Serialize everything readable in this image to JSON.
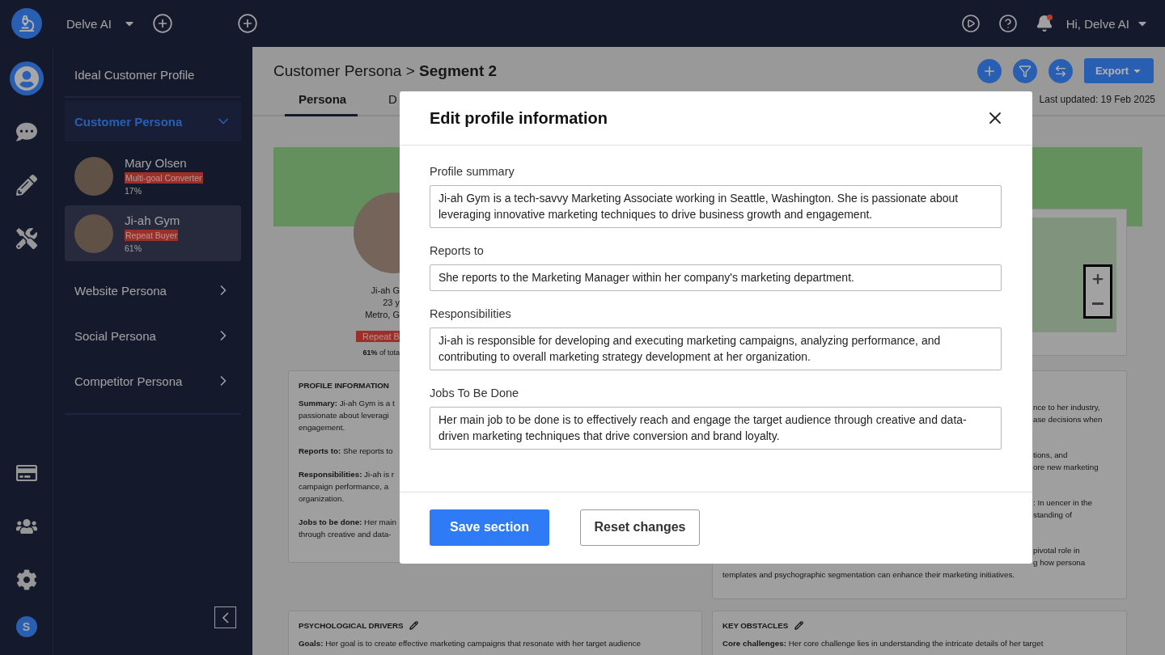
{
  "topbar": {
    "workspace": "Delve AI",
    "greeting": "Hi, Delve AI",
    "notifications_unread": true
  },
  "rail": [
    {
      "kind": "profile",
      "selected": true
    },
    {
      "kind": "chat",
      "selected": false
    },
    {
      "kind": "pencil",
      "selected": false
    },
    {
      "kind": "tools",
      "selected": false
    },
    {
      "kind": "card",
      "selected": false
    },
    {
      "kind": "team",
      "selected": false
    },
    {
      "kind": "settings",
      "selected": false
    }
  ],
  "user_initial": "S",
  "nav": {
    "items": [
      {
        "kind": "link",
        "label": "Ideal Customer Profile"
      },
      {
        "kind": "group",
        "label": "Customer Persona",
        "expanded": true,
        "children": [
          {
            "name": "Mary Olsen",
            "tag": "Multi-goal Converter",
            "share": "17%",
            "selected": false
          },
          {
            "name": "Ji-ah Gym",
            "tag": "Repeat Buyer",
            "share": "61%",
            "selected": true
          }
        ]
      },
      {
        "kind": "group",
        "label": "Website Persona",
        "expanded": false
      },
      {
        "kind": "group",
        "label": "Social Persona",
        "expanded": false
      },
      {
        "kind": "group",
        "label": "Competitor Persona",
        "expanded": false
      }
    ]
  },
  "main": {
    "title": "Customer Persona > **Segment 2**",
    "export_label": "Export",
    "last_updated": "Last updated: 19 Feb 2025",
    "tabs": [
      {
        "label": "Persona",
        "selected": true
      },
      {
        "label": "D",
        "selected": false
      }
    ],
    "persona": {
      "name": "Ji-ah G",
      "age": "23 y",
      "location": "Metro, G",
      "tag": "Repeat B",
      "share": "**61%** of tota"
    },
    "profile_card": {
      "title": "PROFILE INFORMATION",
      "paragraphs": [
        [
          "**Summary:** Ji-ah Gym is a t",
          "passionate about leveragi",
          "engagement."
        ],
        [
          "**Reports to:** She reports to"
        ],
        [
          "**Responsibilities:** Ji-ah is r",
          "campaign performance, a",
          "organization."
        ],
        [
          "**Jobs to be done:** Her main",
          "through creative and data-"
        ]
      ]
    },
    "right_card": {
      "paragraphs": [
        [
          "nce to her industry,",
          "ase decisions when"
        ],
        [
          "tions, and",
          "ore new marketing"
        ],
        [
          ": In uencer in the",
          "standing of"
        ],
        [
          "pivotal role in",
          "g how persona"
        ]
      ],
      "last_line": "templates and psychographic segmentation can enhance their marketing initiatives."
    },
    "bottom_cards": [
      {
        "title": "PSYCHOLOGICAL DRIVERS",
        "text": "**Goals:** Her goal is to create effective marketing campaigns that resonate with her target audience"
      },
      {
        "title": "KEY OBSTACLES",
        "text": "**Core challenges:** Her core challenge lies in understanding the intricate details of her target"
      }
    ]
  },
  "dialog": {
    "title": "Edit profile information",
    "fields": [
      {
        "label": "Profile summary",
        "value": "Ji-ah Gym is a tech-savvy Marketing Associate working in Seattle, Washington. She is passionate about leveraging innovative marketing techniques to drive business growth and engagement."
      },
      {
        "label": "Reports to",
        "value": "She reports to the Marketing Manager within her company's marketing department."
      },
      {
        "label": "Responsibilities",
        "value": "Ji-ah is responsible for developing and executing marketing campaigns, analyzing performance, and contributing to overall marketing strategy development at her organization."
      },
      {
        "label": "Jobs To Be Done",
        "value": "Her main job to be done is to effectively reach and engage the target audience through creative and data-driven marketing techniques that drive conversion and brand loyalty."
      }
    ],
    "primary": "Save section",
    "secondary": "Reset changes"
  }
}
